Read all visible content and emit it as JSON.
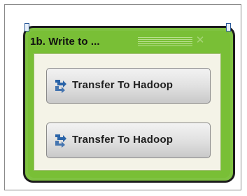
{
  "container": {
    "title": "1b. Write to ..."
  },
  "tasks": [
    {
      "label": "Transfer To Hadoop",
      "icon": "transfer-arrows-icon"
    },
    {
      "label": "Transfer To Hadoop",
      "icon": "transfer-arrows-icon"
    }
  ],
  "colors": {
    "container_green": "#79bf36",
    "body_background": "#f4f3e7",
    "icon_blue": "#2a63a8"
  }
}
